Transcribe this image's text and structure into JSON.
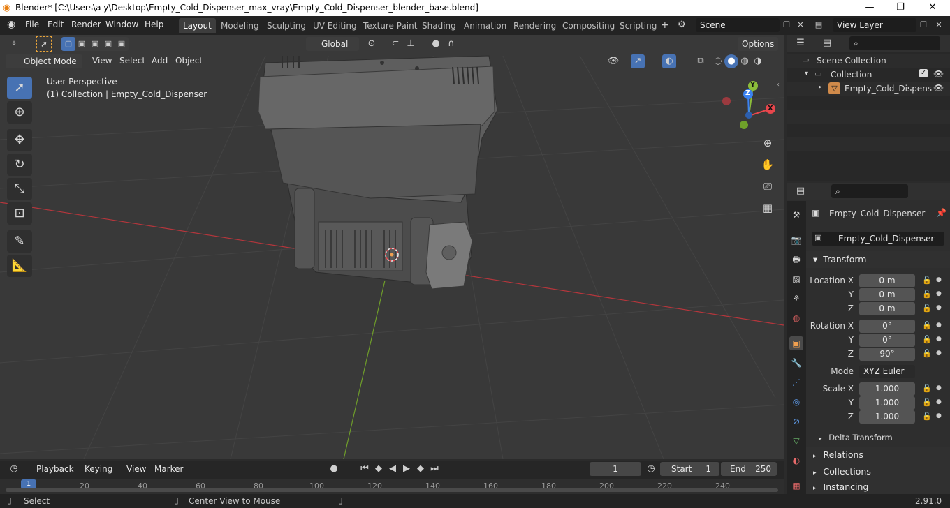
{
  "window": {
    "title": "Blender* [C:\\Users\\a y\\Desktop\\Empty_Cold_Dispenser_max_vray\\Empty_Cold_Dispenser_blender_base.blend]",
    "minimize": "—",
    "maximize": "❐",
    "close": "✕"
  },
  "menu": [
    "File",
    "Edit",
    "Render",
    "Window",
    "Help"
  ],
  "workspaces": [
    "Layout",
    "Modeling",
    "Sculpting",
    "UV Editing",
    "Texture Paint",
    "Shading",
    "Animation",
    "Rendering",
    "Compositing",
    "Scripting"
  ],
  "add_workspace": "+",
  "scene": {
    "name": "Scene",
    "view_layer": "View Layer"
  },
  "viewport": {
    "mode": "Object Mode",
    "menus": [
      "View",
      "Select",
      "Add",
      "Object"
    ],
    "transform_orientation": "Global",
    "options_label": "Options",
    "overlay_title": "User Perspective",
    "overlay_subtitle": "(1) Collection | Empty_Cold_Dispenser",
    "gizmo": {
      "x": "X",
      "y": "Y",
      "z": "Z"
    }
  },
  "outliner": {
    "root": "Scene Collection",
    "collection": "Collection",
    "object": "Empty_Cold_Dispens"
  },
  "properties": {
    "object_name": "Empty_Cold_Dispenser",
    "object_field": "Empty_Cold_Dispenser",
    "transform_label": "Transform",
    "location_label": "Location X",
    "rotation_label": "Rotation X",
    "scale_label": "Scale X",
    "y_label": "Y",
    "z_label": "Z",
    "location": [
      "0 m",
      "0 m",
      "0 m"
    ],
    "rotation": [
      "0°",
      "0°",
      "90°"
    ],
    "mode_label": "Mode",
    "mode_value": "XYZ Euler",
    "scale": [
      "1.000",
      "1.000",
      "1.000"
    ],
    "delta_transform": "Delta Transform",
    "relations": "Relations",
    "collections": "Collections",
    "instancing": "Instancing"
  },
  "timeline": {
    "menus": [
      "Playback",
      "Keying",
      "View",
      "Marker"
    ],
    "current_frame": "1",
    "start_label": "Start",
    "start": "1",
    "end_label": "End",
    "end": "250",
    "ticks": [
      "1",
      "20",
      "40",
      "60",
      "80",
      "100",
      "120",
      "140",
      "160",
      "180",
      "200",
      "220",
      "240"
    ]
  },
  "status": {
    "select": "Select",
    "center_view": "Center View to Mouse",
    "version": "2.91.0"
  },
  "colors": {
    "accent": "#4772b3",
    "x_axis": "#e8464c",
    "y_axis": "#8bbc3a",
    "z_axis": "#3b82f0",
    "active_object": "#f0a050"
  }
}
